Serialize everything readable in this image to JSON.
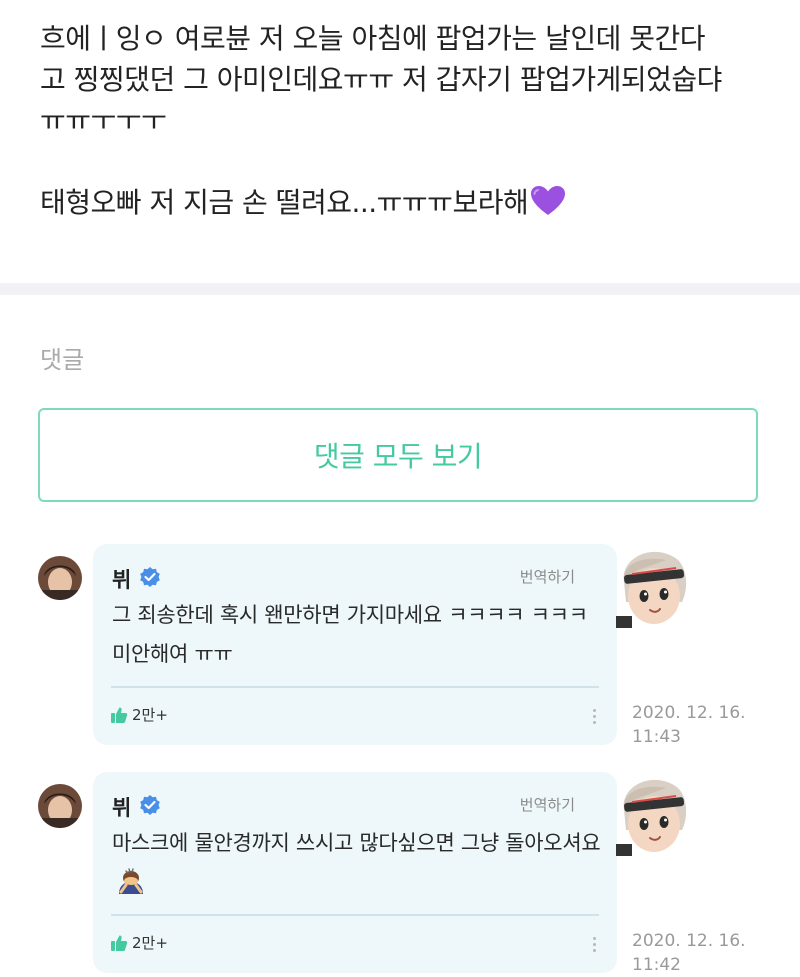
{
  "post": {
    "line1": "흐에ㅣ잉ㅇ 여로뷴 저 오늘 아침에 팝업가는 날인데 못간다",
    "line2": "고 찡찡댔던 그 아미인데요ㅠㅠ 저 갑자기 팝업가게되었숩댜",
    "line3": "ㅠㅠㅜㅜㅜ",
    "line4": "태형오빠 저 지금 손 떨려요...ㅠㅠㅠ보라해",
    "heart_icon": "purple-heart-icon"
  },
  "comments_section": {
    "label": "댓글",
    "view_all_label": "댓글 모두 보기"
  },
  "comments": [
    {
      "author": "뷔",
      "translate_label": "번역하기",
      "text": "그 죄송한데 혹시 왠만하면 가지마세요 ㅋㅋㅋㅋ ㅋㅋㅋ 미안해여 ㅠㅠ",
      "likes": "2만+",
      "date": "2020. 12. 16.",
      "time": "11:43"
    },
    {
      "author": "뷔",
      "translate_label": "번역하기",
      "text": "마스크에 물안경까지 쓰시고 많다싶으면 그냥 돌아오셔요",
      "emoji": "bowing-person-emoji",
      "likes": "2만+",
      "date": "2020. 12. 16.",
      "time": "11:42"
    }
  ],
  "colors": {
    "accent_green": "#44c9a0",
    "bubble_bg": "#eef8fb",
    "verified_blue": "#4a8fe7",
    "heart_purple": "#9b51e0"
  }
}
